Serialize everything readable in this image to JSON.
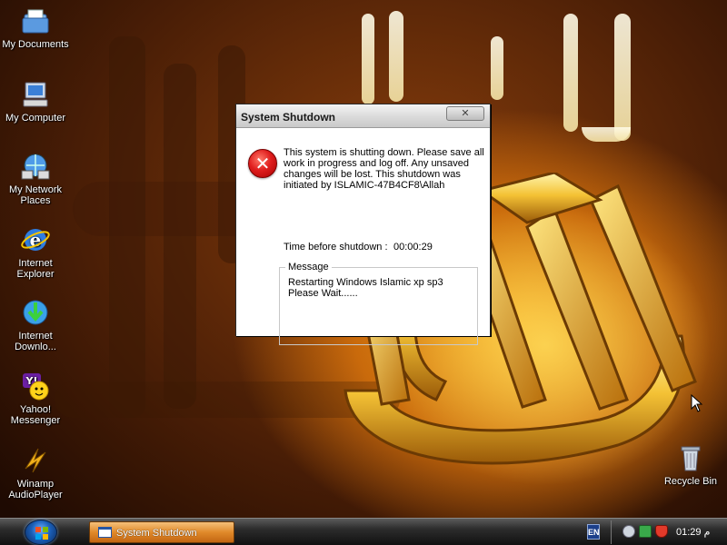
{
  "desktop": {
    "icons": [
      {
        "label": "My Documents",
        "icon": "my-documents-icon"
      },
      {
        "label": "My Computer",
        "icon": "my-computer-icon"
      },
      {
        "label": "My Network Places",
        "icon": "network-places-icon"
      },
      {
        "label": "Internet Explorer",
        "icon": "internet-explorer-icon"
      },
      {
        "label": "Internet Downlo...",
        "icon": "internet-download-manager-icon"
      },
      {
        "label": "Yahoo! Messenger",
        "icon": "yahoo-messenger-icon"
      },
      {
        "label": "Winamp AudioPlayer",
        "icon": "winamp-icon"
      },
      {
        "label": "Recycle Bin",
        "icon": "recycle-bin-icon"
      }
    ]
  },
  "dialog": {
    "title": "System Shutdown",
    "close_glyph": "✕",
    "icon": "error-icon",
    "message": "This system is shutting down. Please save all work in progress and log off. Any unsaved changes will be lost. This shutdown was initiated by ISLAMIC-47B4CF8\\Allah",
    "timer_label": "Time before shutdown :",
    "timer_value": "00:00:29",
    "group_label": "Message",
    "group_lines": [
      "Restarting Windows Islamic xp sp3",
      "Please Wait......"
    ]
  },
  "taskbar": {
    "start_icon": "windows-start-orb-icon",
    "task_button_label": "System Shutdown",
    "language": "EN",
    "tray_icons": [
      "network-tray-icon",
      "security-tray-icon",
      "shield-tray-icon"
    ],
    "clock": "01:29 م"
  },
  "colors": {
    "dialog_bg": "#ece9d8",
    "task_button": "#e08a2a",
    "error_red": "#e01e1e"
  }
}
